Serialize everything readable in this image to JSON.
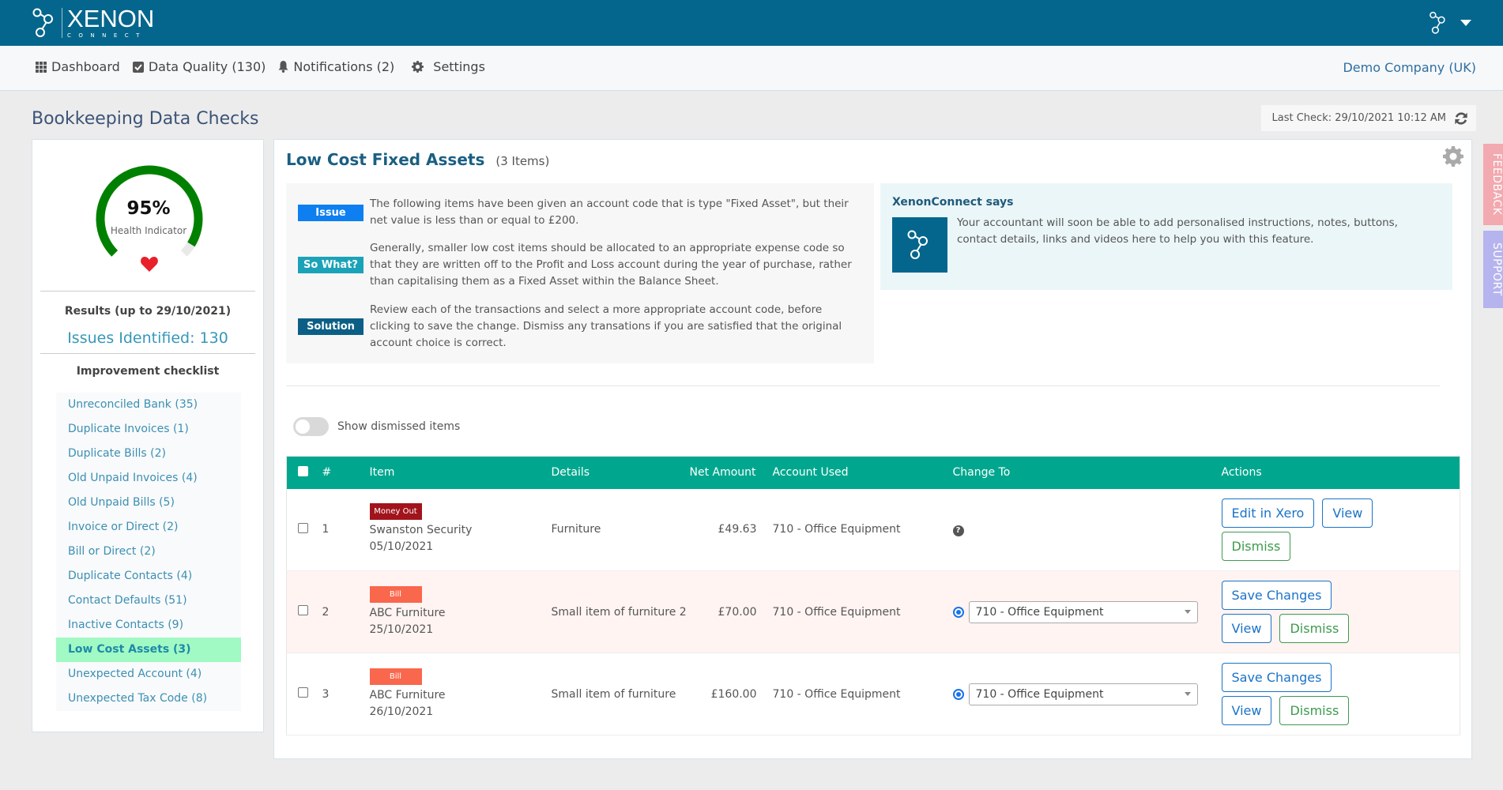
{
  "app": {
    "logo_word": "XENON",
    "logo_sub": "CONNECT"
  },
  "nav": {
    "items": [
      {
        "label": "Dashboard",
        "icon": "grid-icon"
      },
      {
        "label": "Data Quality (130)",
        "icon": "checkbox-icon"
      },
      {
        "label": "Notifications (2)",
        "icon": "bell-icon"
      },
      {
        "label": "Settings",
        "icon": "gear-icon"
      }
    ],
    "company": "Demo Company (UK)"
  },
  "page": {
    "title": "Bookkeeping Data Checks",
    "last_check": "Last Check: 29/10/2021 10:12 AM"
  },
  "health": {
    "value_label": "95%",
    "value_fraction": 0.95,
    "label": "Health Indicator",
    "color": "#008000"
  },
  "results": {
    "label": "Results (up to 29/10/2021)",
    "issues": "Issues Identified: 130",
    "checklist_title": "Improvement checklist",
    "checklist": [
      {
        "label": "Unreconciled Bank (35)",
        "active": false
      },
      {
        "label": "Duplicate Invoices (1)",
        "active": false
      },
      {
        "label": "Duplicate Bills (2)",
        "active": false
      },
      {
        "label": "Old Unpaid Invoices (4)",
        "active": false
      },
      {
        "label": "Old Unpaid Bills (5)",
        "active": false
      },
      {
        "label": "Invoice or Direct (2)",
        "active": false
      },
      {
        "label": "Bill or Direct (2)",
        "active": false
      },
      {
        "label": "Duplicate Contacts (4)",
        "active": false
      },
      {
        "label": "Contact Defaults (51)",
        "active": false
      },
      {
        "label": "Inactive Contacts (9)",
        "active": false
      },
      {
        "label": "Low Cost Assets (3)",
        "active": true
      },
      {
        "label": "Unexpected Account (4)",
        "active": false
      },
      {
        "label": "Unexpected Tax Code (8)",
        "active": false
      }
    ]
  },
  "section": {
    "title": "Low Cost Fixed Assets",
    "count": "(3 Items)"
  },
  "info": [
    {
      "badge": "Issue",
      "color": "#0d7ff0",
      "text": "The following items have been given an account code that is type \"Fixed Asset\", but their net value is less than or equal to £200."
    },
    {
      "badge": "So What?",
      "color": "#1aa3b8",
      "text": "Generally, smaller low cost items should be allocated to an appropriate expense code so that they are written off to the Profit and Loss account during the year of purchase, rather than capitalising them as a Fixed Asset within the Balance Sheet."
    },
    {
      "badge": "Solution",
      "color": "#0b5f86",
      "text": "Review each of the transactions and select a more appropriate account code, before clicking to save the change. Dismiss any transations if you are satisfied that the original account choice is correct."
    }
  ],
  "xenon_says": {
    "title": "XenonConnect says",
    "text": "Your accountant will soon be able to add personalised instructions, notes, buttons, contact details, links and videos here to help you with this feature."
  },
  "toggle": {
    "label": "Show dismissed items",
    "on": false
  },
  "table": {
    "headers": [
      "#",
      "Item",
      "Details",
      "Net Amount",
      "Account Used",
      "Change To",
      "Actions"
    ],
    "rows": [
      {
        "num": "1",
        "type": "Money Out",
        "type_color": "#a1141c",
        "name": "Swanston Security",
        "date": "05/10/2021",
        "details": "Furniture",
        "amount": "£49.63",
        "account": "710 - Office Equipment",
        "change_to": null,
        "actions": [
          "Edit in Xero",
          "View",
          "Dismiss"
        ]
      },
      {
        "num": "2",
        "type": "Bill",
        "type_color": "#f9674c",
        "name": "ABC Furniture",
        "date": "25/10/2021",
        "details": "Small item of furniture 2",
        "amount": "£70.00",
        "account": "710 - Office Equipment",
        "change_to": "710 - Office Equipment",
        "actions": [
          "Save Changes",
          "View",
          "Dismiss"
        ]
      },
      {
        "num": "3",
        "type": "Bill",
        "type_color": "#f9674c",
        "name": "ABC Furniture",
        "date": "26/10/2021",
        "details": "Small item of furniture",
        "amount": "£160.00",
        "account": "710 - Office Equipment",
        "change_to": "710 - Office Equipment",
        "actions": [
          "Save Changes",
          "View",
          "Dismiss"
        ]
      }
    ]
  },
  "side_tabs": {
    "feedback": "FEEDBACK",
    "support": "SUPPORT"
  },
  "colors": {
    "brand": "#05668d",
    "table_header": "#00a78e",
    "active_item": "#a1f9c4"
  }
}
